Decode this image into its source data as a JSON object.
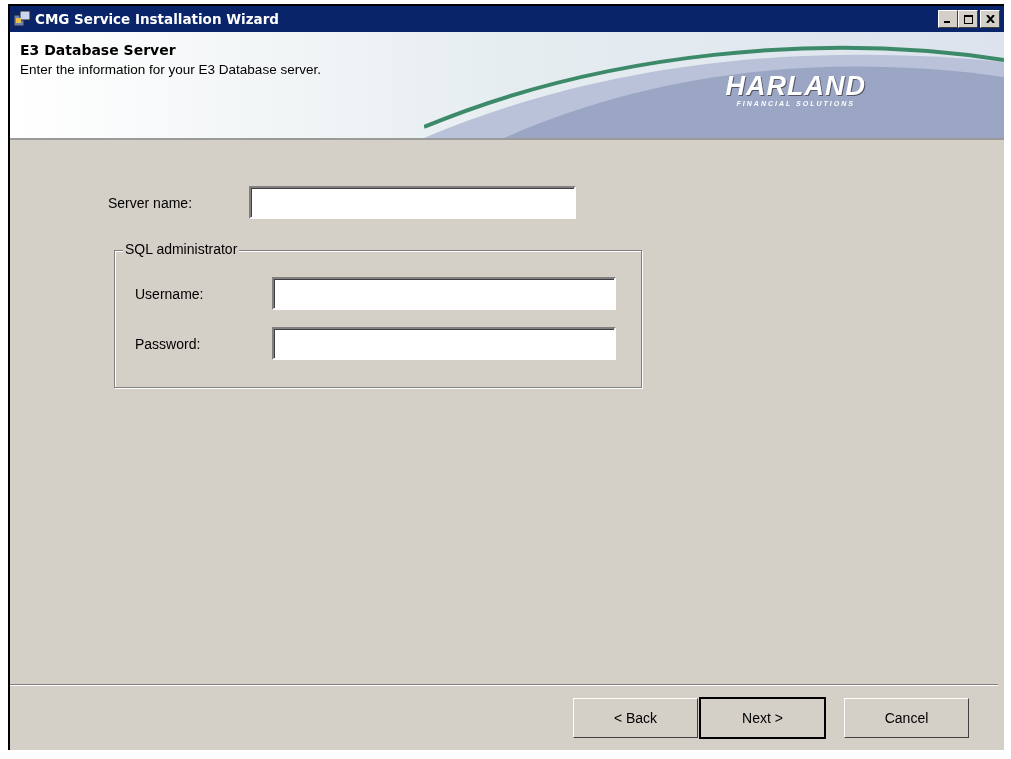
{
  "window": {
    "title": "CMG Service Installation Wizard"
  },
  "header": {
    "title": "E3 Database Server",
    "subtitle": "Enter the information for your E3 Database server.",
    "logo": {
      "name": "HARLAND",
      "tagline": "FINANCIAL SOLUTIONS"
    }
  },
  "server_name": {
    "label": "Server name:"
  },
  "group": {
    "title": "SQL administrator",
    "fields": [
      {
        "label": "Username:"
      },
      {
        "label": "Password:"
      }
    ]
  },
  "buttons": [
    {
      "label": "< Back",
      "default": false
    },
    {
      "label": "Next >",
      "default": true
    },
    {
      "label": "Cancel",
      "default": false
    }
  ]
}
